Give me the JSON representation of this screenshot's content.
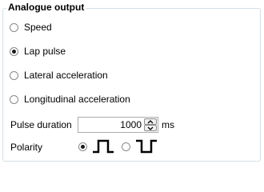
{
  "group": {
    "title": "Analogue output"
  },
  "options": [
    {
      "label": "Speed",
      "checked": false
    },
    {
      "label": "Lap pulse",
      "checked": true
    },
    {
      "label": "Lateral acceleration",
      "checked": false
    },
    {
      "label": "Longitudinal acceleration",
      "checked": false
    }
  ],
  "pulse_duration": {
    "label": "Pulse duration",
    "value": "1000",
    "unit": "ms"
  },
  "polarity": {
    "label": "Polarity",
    "positive_selected": true,
    "negative_selected": false,
    "positive_icon": "positive-pulse-icon",
    "negative_icon": "negative-pulse-icon"
  }
}
